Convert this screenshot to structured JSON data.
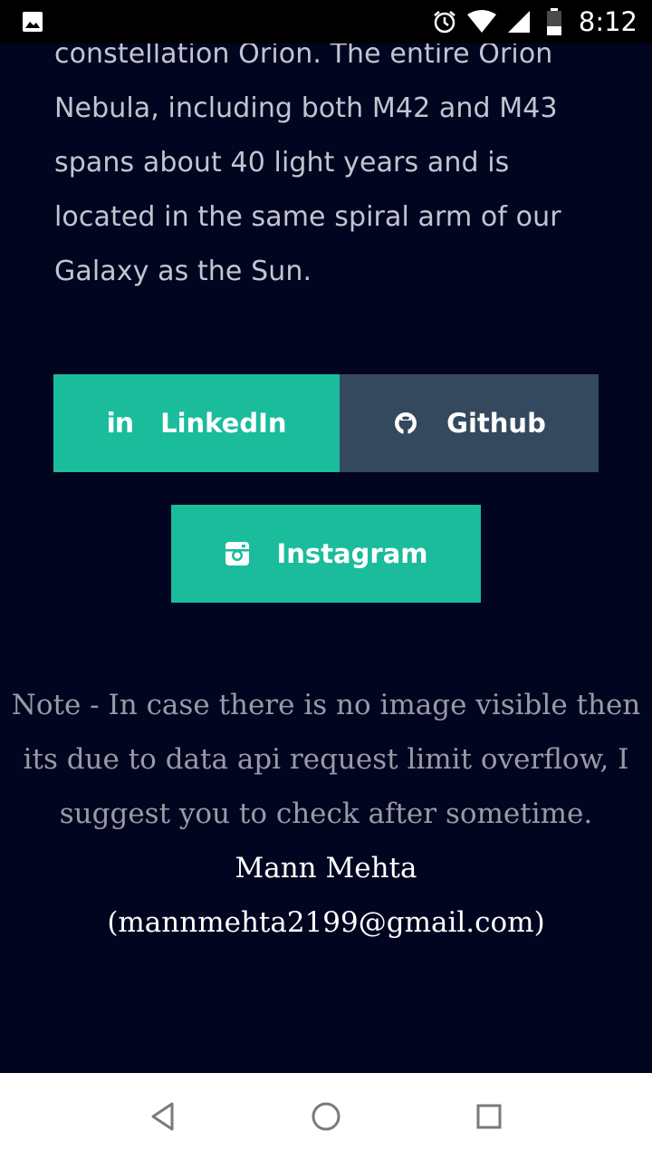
{
  "status_bar": {
    "time": "8:12",
    "icons": [
      "gallery-icon",
      "alarm-icon",
      "wifi-icon",
      "signal-icon",
      "battery-icon"
    ]
  },
  "article": {
    "lines": [
      "constellation Orion. The entire Orion",
      "Nebula, including both M42 and M43",
      "spans about 40 light years and is",
      "located in the same spiral arm of our",
      "Galaxy as the Sun."
    ]
  },
  "social": {
    "linkedin": {
      "label": "LinkedIn",
      "icon": "linkedin-icon",
      "color": "#1abc9c"
    },
    "github": {
      "label": "Github",
      "icon": "github-icon",
      "color": "#34495e"
    },
    "instagram": {
      "label": "Instagram",
      "icon": "instagram-icon",
      "color": "#1abc9c"
    }
  },
  "footer": {
    "note_lines": [
      "Note - In case there is no image visible then",
      "its due to data api request limit overflow, I",
      "suggest you to check after sometime."
    ],
    "author": "Mann Mehta",
    "email": "(mannmehta2199@gmail.com)"
  },
  "nav_bar": {
    "icons": [
      "back-icon",
      "home-icon",
      "recents-icon"
    ]
  },
  "colors": {
    "page_background": "#020520",
    "accent": "#1abc9c",
    "secondary": "#34495e"
  }
}
